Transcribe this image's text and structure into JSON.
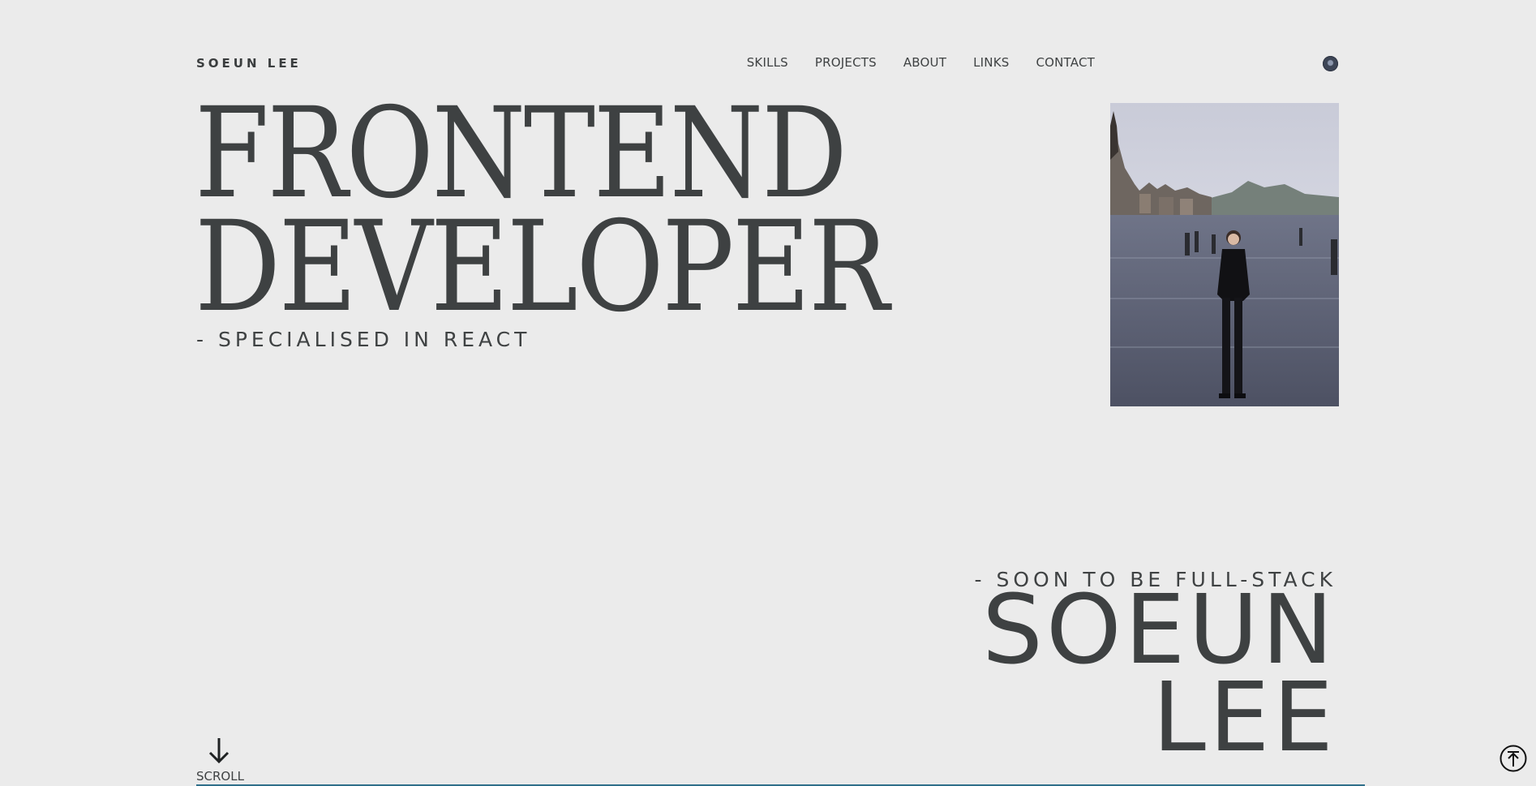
{
  "header": {
    "brand": "SOEUN LEE",
    "nav": [
      "SKILLS",
      "PROJECTS",
      "ABOUT",
      "LINKS",
      "CONTACT"
    ],
    "theme_toggle_icon": "moon-toggle-icon"
  },
  "hero": {
    "title_line1": "FRONTEND",
    "title_line2": "DEVELOPER",
    "subtitle": "- SPECIALISED IN REACT"
  },
  "profile": {
    "secondary_subtitle": "- SOON TO BE FULL-STACK",
    "name_line1": "SOEUN",
    "name_line2": "LEE"
  },
  "scroll": {
    "label": "SCROLL",
    "icon": "arrow-down-icon"
  },
  "back_to_top": {
    "icon": "arrow-up-circle-icon"
  },
  "colors": {
    "background": "#ebebeb",
    "text": "#3f4243",
    "accent_line": "#2f6f8a"
  }
}
